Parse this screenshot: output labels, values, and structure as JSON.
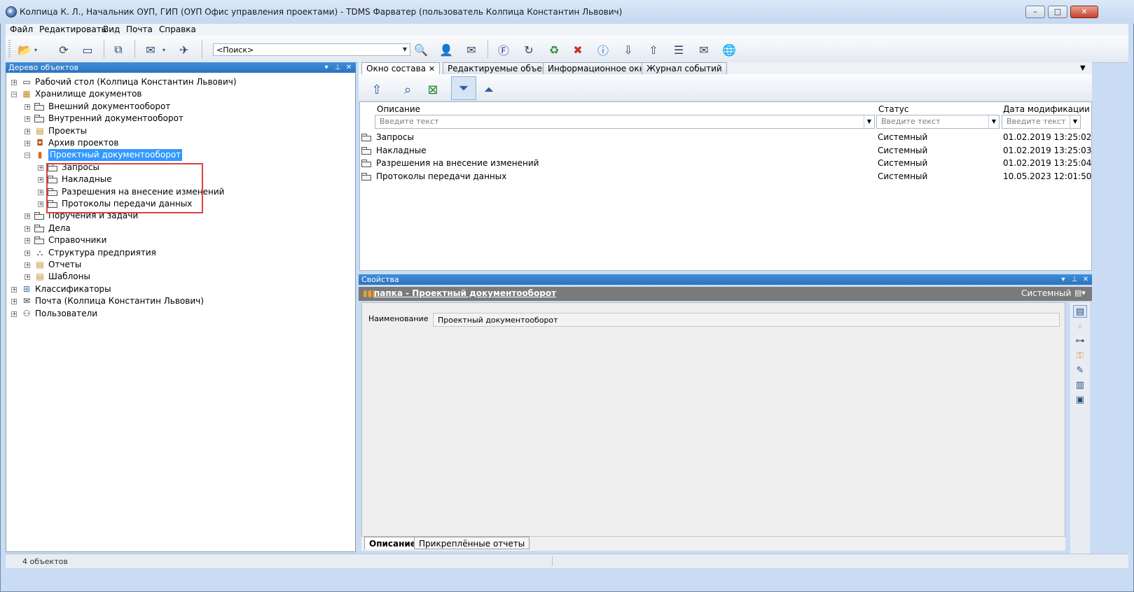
{
  "window": {
    "title": "Колпица К. Л., Начальник ОУП, ГИП (ОУП Офис управления проектами) - TDMS Фарватер (пользователь Колпица Константин Львович)",
    "minimize": "–",
    "maximize": "□",
    "close": "✕"
  },
  "menu": [
    "Файл",
    "Редактировать",
    "Вид",
    "Почта",
    "Справка"
  ],
  "toolbar": {
    "search_placeholder": "<Поиск>"
  },
  "tree": {
    "header": "Дерево объектов",
    "items": [
      {
        "label": "Рабочий стол (Колпица Константин Львович)",
        "icon": "desktop-icon"
      },
      {
        "label": "Хранилище документов",
        "icon": "storage-icon"
      },
      {
        "label": "Внешний документооборот",
        "icon": "folder-icon"
      },
      {
        "label": "Внутренний документооборот",
        "icon": "folder-icon"
      },
      {
        "label": "Проекты",
        "icon": "projects-icon"
      },
      {
        "label": "Архив проектов",
        "icon": "archive-icon"
      },
      {
        "label": "Проектный документооборот",
        "icon": "books-icon"
      },
      {
        "label": "Запросы",
        "icon": "folder-icon"
      },
      {
        "label": "Накладные",
        "icon": "folder-icon"
      },
      {
        "label": "Разрешения на внесение изменений",
        "icon": "folder-icon"
      },
      {
        "label": "Протоколы передачи данных",
        "icon": "folder-icon"
      },
      {
        "label": "Поручения и задачи",
        "icon": "folder-icon"
      },
      {
        "label": "Дела",
        "icon": "folder-icon"
      },
      {
        "label": "Справочники",
        "icon": "folder-icon"
      },
      {
        "label": "Структура предприятия",
        "icon": "org-structure-icon"
      },
      {
        "label": "Отчеты",
        "icon": "reports-icon"
      },
      {
        "label": "Шаблоны",
        "icon": "templates-icon"
      },
      {
        "label": "Классификаторы",
        "icon": "classifier-icon"
      },
      {
        "label": "Почта (Колпица Константин Львович)",
        "icon": "mail-icon"
      },
      {
        "label": "Пользователи",
        "icon": "users-icon"
      }
    ]
  },
  "tabs": [
    "Окно состава",
    "Редактируемые объекты",
    "Информационное окно",
    "Журнал событий"
  ],
  "grid": {
    "columns": [
      "Описание",
      "Статус",
      "Дата модификации"
    ],
    "filter_placeholder": "Введите текст",
    "rows": [
      {
        "name": "Запросы",
        "status": "Системный",
        "date": "01.02.2019 13:25:02"
      },
      {
        "name": "Накладные",
        "status": "Системный",
        "date": "01.02.2019 13:25:03"
      },
      {
        "name": "Разрешения на внесение изменений",
        "status": "Системный",
        "date": "01.02.2019 13:25:04"
      },
      {
        "name": "Протоколы передачи данных",
        "status": "Системный",
        "date": "10.05.2023 12:01:50"
      }
    ]
  },
  "properties": {
    "header": "Свойства",
    "object_link": "папка - Проектный документооборот",
    "object_status": "Системный",
    "name_label": "Наименование",
    "name_value": "Проектный документооборот",
    "bottom_tabs": [
      "Описание",
      "Прикреплённые отчеты"
    ]
  },
  "status": {
    "count": "4 объектов"
  },
  "colors": {
    "pane_header": "#2b7fd0",
    "selection": "#3399ff",
    "highlight_box": "#d8433f"
  }
}
